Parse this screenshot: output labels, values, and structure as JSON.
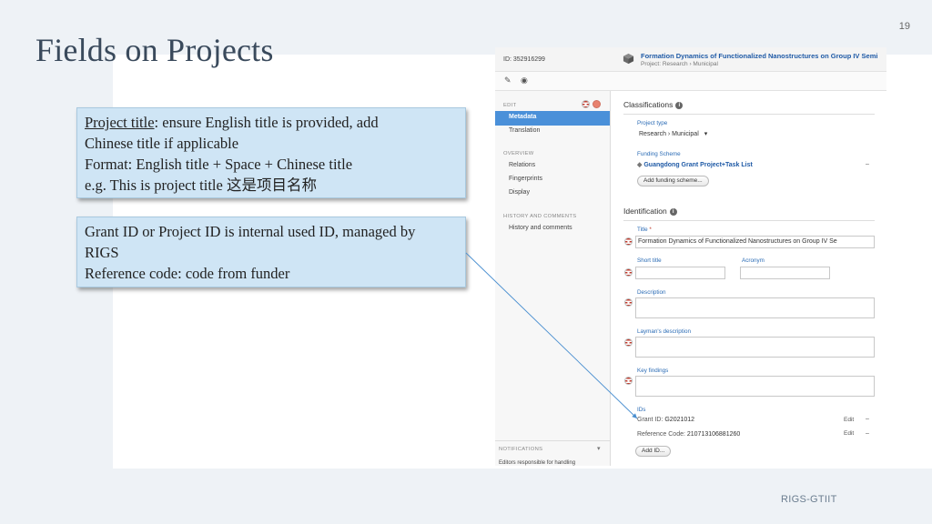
{
  "slide": {
    "title": "Fields on Projects",
    "page_number": "19",
    "footer": "RIGS-GTIIT"
  },
  "callout1": {
    "line1_underlined": "Project title",
    "line1_rest": ": ensure English title is provided, add",
    "line2": "Chinese title if applicable",
    "line3": "Format: English title + Space + Chinese title",
    "line4": "e.g. This is project title 这是项目名称"
  },
  "callout2": {
    "line1": "Grant ID or Project ID is internal used ID, managed by",
    "line2": "RIGS",
    "line3": "Reference code: code from funder"
  },
  "screenshot": {
    "id_label": "ID: 352916299",
    "project_title": "Formation Dynamics of Functionalized Nanostructures on Group IV Semi",
    "project_subtitle": "Project: Research › Municipal",
    "toolbar": {
      "edit_icon": "pencil-icon",
      "view_icon": "eye-icon"
    },
    "sidebar": {
      "edit_header": "EDIT",
      "metadata": "Metadata",
      "translation": "Translation",
      "overview_header": "OVERVIEW",
      "relations": "Relations",
      "fingerprints": "Fingerprints",
      "display": "Display",
      "history_header": "HISTORY AND COMMENTS",
      "history": "History and comments",
      "notifications_header": "NOTIFICATIONS",
      "notifications_text": "Editors responsible for handling"
    },
    "classifications": {
      "heading": "Classifications",
      "project_type_label": "Project type",
      "project_type_value": "Research › Municipal",
      "funding_scheme_label": "Funding Scheme",
      "funding_scheme_value": "Guangdong Grant Project+Task List",
      "add_funding_button": "Add funding scheme..."
    },
    "identification": {
      "heading": "Identification",
      "title_label": "Title",
      "title_value": "Formation Dynamics of Functionalized Nanostructures on Group IV Se",
      "short_title_label": "Short title",
      "acronym_label": "Acronym",
      "description_label": "Description",
      "laymans_label": "Layman's description",
      "key_findings_label": "Key findings",
      "ids_label": "IDs",
      "grant_id_label": "Grant ID:",
      "grant_id_value": "G2021012",
      "reference_code_label": "Reference Code:",
      "reference_code_value": "210713106881260",
      "edit_label": "Edit",
      "dash": "–",
      "add_id_button": "Add ID..."
    }
  }
}
